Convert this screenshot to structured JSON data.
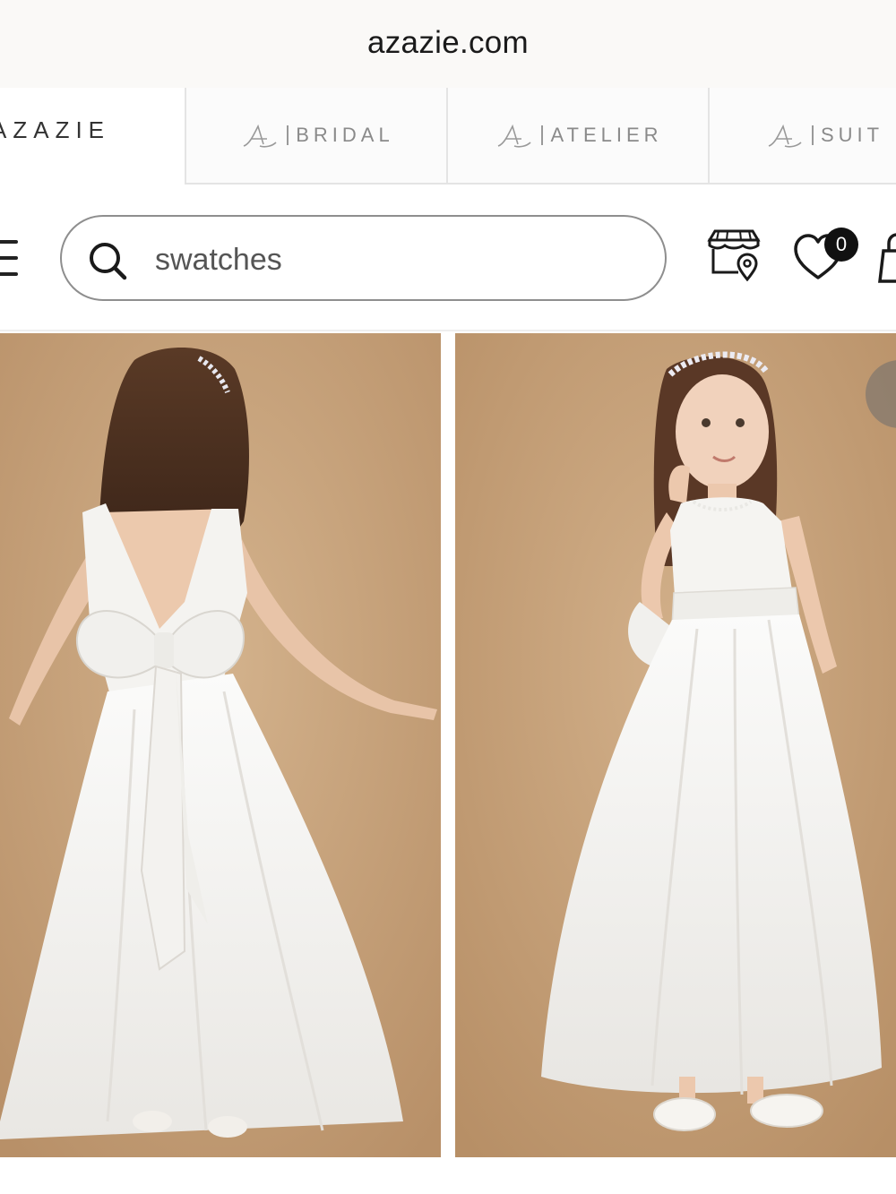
{
  "browser": {
    "url": "azazie.com"
  },
  "brands": {
    "main": "AZAZIE",
    "tabs": [
      {
        "label": "BRIDAL"
      },
      {
        "label": "ATELIER"
      },
      {
        "label": "SUIT"
      }
    ]
  },
  "header": {
    "search": {
      "value": "swatches",
      "icon": "search-icon"
    },
    "icons": {
      "menu": "menu-icon",
      "store": "store-locator-icon",
      "wishlist": "heart-icon",
      "bag": "shopping-bag-icon"
    },
    "wishlist_count": "0"
  },
  "gallery": {
    "images": [
      {
        "name": "dress-back-view"
      },
      {
        "name": "dress-front-view"
      }
    ],
    "colors": {
      "backdrop": "#c8a27a",
      "dress": "#f7f6f3"
    }
  }
}
